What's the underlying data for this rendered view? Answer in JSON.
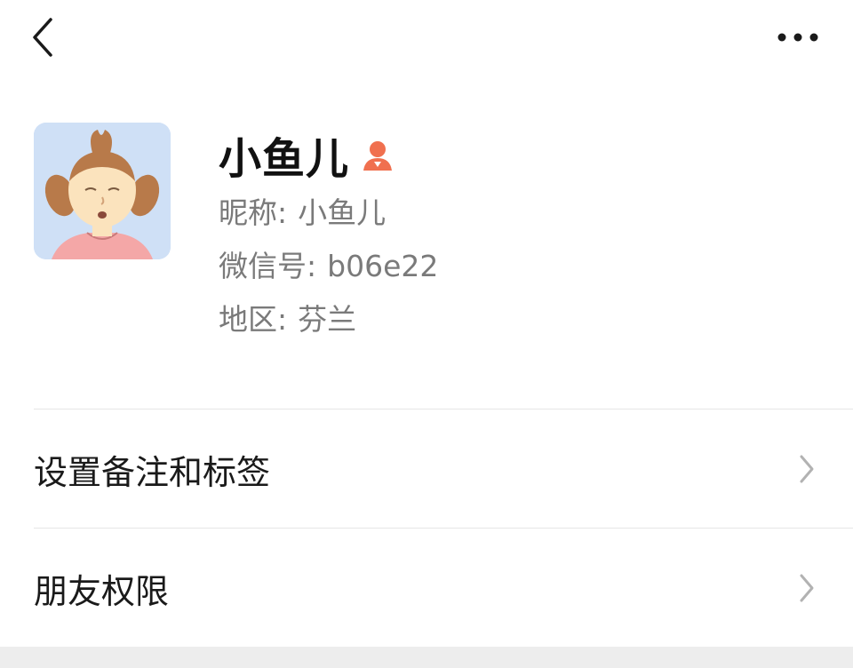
{
  "topbar": {
    "back_icon": "chevron-left-icon",
    "more_icon": "more-horizontal-icon"
  },
  "profile": {
    "display_name": "小鱼儿",
    "gender_icon": "female-user-icon",
    "gender_color": "#f0704f",
    "nickname_label": "昵称:",
    "nickname_value": "小鱼儿",
    "wechat_id_label": "微信号:",
    "wechat_id_value": "b06e22",
    "region_label": "地区:",
    "region_value": "芬兰"
  },
  "menu": {
    "items": [
      {
        "label": "设置备注和标签",
        "icon": "chevron-right-icon"
      },
      {
        "label": "朋友权限",
        "icon": "chevron-right-icon"
      }
    ]
  },
  "colors": {
    "background": "#ffffff",
    "divider": "#e6e6e6",
    "secondary_text": "#7a7a7a",
    "chevron": "#b2b2b2"
  }
}
